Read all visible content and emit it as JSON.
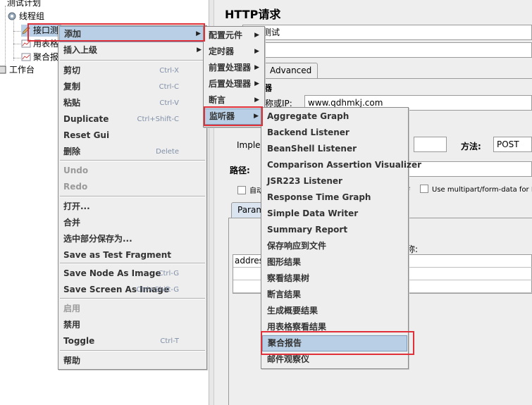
{
  "tree": {
    "test_plan": "测试计划",
    "thread_group": "线程组",
    "http_sampler": "接口测",
    "table_results": "用表格",
    "aggregate": "聚合报",
    "workbench": "工作台"
  },
  "http_panel": {
    "title": "HTTP请求",
    "name_value": "接口测试",
    "tab_advanced": "Advanced",
    "server_section": "器",
    "server_label": "称或IP:",
    "server_value": "www.qdhmkj.com",
    "impl_label": "Imple",
    "method_label": "方法:",
    "method_value": "POST",
    "path_label": "路径:",
    "auto_label": "自动",
    "e_label": "e",
    "multipart_label": "Use multipart/form-data for PO",
    "params_tab": "Param",
    "name_col_label": "称:",
    "param_row": "addres"
  },
  "context_menu": {
    "items": [
      {
        "label": "添加",
        "shortcut": "",
        "submenu": true,
        "selected": true,
        "disabled": false
      },
      {
        "label": "插入上级",
        "shortcut": "",
        "submenu": true,
        "selected": false,
        "disabled": false
      },
      {
        "label": "剪切",
        "shortcut": "Ctrl-X",
        "submenu": false,
        "selected": false,
        "disabled": false
      },
      {
        "label": "复制",
        "shortcut": "Ctrl-C",
        "submenu": false,
        "selected": false,
        "disabled": false
      },
      {
        "label": "粘贴",
        "shortcut": "Ctrl-V",
        "submenu": false,
        "selected": false,
        "disabled": false
      },
      {
        "label": "Duplicate",
        "shortcut": "Ctrl+Shift-C",
        "submenu": false,
        "selected": false,
        "disabled": false
      },
      {
        "label": "Reset Gui",
        "shortcut": "",
        "submenu": false,
        "selected": false,
        "disabled": false
      },
      {
        "label": "删除",
        "shortcut": "Delete",
        "submenu": false,
        "selected": false,
        "disabled": false
      },
      {
        "label": "Undo",
        "shortcut": "",
        "submenu": false,
        "selected": false,
        "disabled": true
      },
      {
        "label": "Redo",
        "shortcut": "",
        "submenu": false,
        "selected": false,
        "disabled": true
      },
      {
        "label": "打开...",
        "shortcut": "",
        "submenu": false,
        "selected": false,
        "disabled": false
      },
      {
        "label": "合并",
        "shortcut": "",
        "submenu": false,
        "selected": false,
        "disabled": false
      },
      {
        "label": "选中部分保存为...",
        "shortcut": "",
        "submenu": false,
        "selected": false,
        "disabled": false
      },
      {
        "label": "Save as Test Fragment",
        "shortcut": "",
        "submenu": false,
        "selected": false,
        "disabled": false
      },
      {
        "label": "Save Node As Image",
        "shortcut": "Ctrl-G",
        "submenu": false,
        "selected": false,
        "disabled": false
      },
      {
        "label": "Save Screen As Image",
        "shortcut": "Ctrl+Shift-G",
        "submenu": false,
        "selected": false,
        "disabled": false
      },
      {
        "label": "启用",
        "shortcut": "",
        "submenu": false,
        "selected": false,
        "disabled": true
      },
      {
        "label": "禁用",
        "shortcut": "",
        "submenu": false,
        "selected": false,
        "disabled": false
      },
      {
        "label": "Toggle",
        "shortcut": "Ctrl-T",
        "submenu": false,
        "selected": false,
        "disabled": false
      },
      {
        "label": "帮助",
        "shortcut": "",
        "submenu": false,
        "selected": false,
        "disabled": false
      }
    ]
  },
  "add_submenu": {
    "items": [
      {
        "label": "配置元件",
        "selected": false
      },
      {
        "label": "定时器",
        "selected": false
      },
      {
        "label": "前置处理器",
        "selected": false
      },
      {
        "label": "后置处理器",
        "selected": false
      },
      {
        "label": "断言",
        "selected": false
      },
      {
        "label": "监听器",
        "selected": true
      }
    ]
  },
  "listener_submenu": {
    "items": [
      {
        "label": "Aggregate Graph",
        "selected": false
      },
      {
        "label": "Backend Listener",
        "selected": false
      },
      {
        "label": "BeanShell Listener",
        "selected": false
      },
      {
        "label": "Comparison Assertion Visualizer",
        "selected": false
      },
      {
        "label": "JSR223 Listener",
        "selected": false
      },
      {
        "label": "Response Time Graph",
        "selected": false
      },
      {
        "label": "Simple Data Writer",
        "selected": false
      },
      {
        "label": "Summary Report",
        "selected": false
      },
      {
        "label": "保存响应到文件",
        "selected": false
      },
      {
        "label": "图形结果",
        "selected": false
      },
      {
        "label": "察看结果树",
        "selected": false
      },
      {
        "label": "断言结果",
        "selected": false
      },
      {
        "label": "生成概要结果",
        "selected": false
      },
      {
        "label": "用表格察看结果",
        "selected": false
      },
      {
        "label": "聚合报告",
        "selected": true
      },
      {
        "label": "邮件观察仪",
        "selected": false
      }
    ]
  },
  "colors": {
    "highlight": "#b8cfe5",
    "annotation_red": "#e0303a"
  }
}
